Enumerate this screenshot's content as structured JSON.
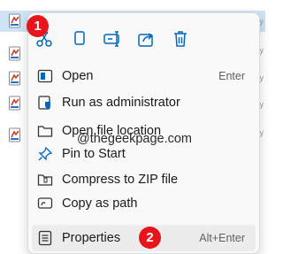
{
  "file_list": {
    "file_icons": [
      "file-icon",
      "file-icon",
      "file-icon",
      "file-icon",
      "file-icon"
    ]
  },
  "context_menu": {
    "toolbar": [
      {
        "name": "cut-icon"
      },
      {
        "name": "copy-icon"
      },
      {
        "name": "rename-icon"
      },
      {
        "name": "share-icon"
      },
      {
        "name": "delete-icon"
      }
    ],
    "items": [
      {
        "label": "Open",
        "shortcut": "Enter",
        "icon": "open-icon"
      },
      {
        "label": "Run as administrator",
        "shortcut": "",
        "icon": "admin-shield-icon"
      },
      {
        "label": "Open file location",
        "shortcut": "",
        "icon": "folder-icon"
      },
      {
        "label": "Pin to Start",
        "shortcut": "",
        "icon": "pin-icon"
      },
      {
        "label": "Compress to ZIP file",
        "shortcut": "",
        "icon": "zip-icon"
      },
      {
        "label": "Copy as path",
        "shortcut": "",
        "icon": "copy-path-icon"
      },
      {
        "label": "Properties",
        "shortcut": "Alt+Enter",
        "icon": "properties-icon"
      }
    ]
  },
  "watermark": "@thegeekpage.com",
  "annotations": {
    "badge_1": "1",
    "badge_2": "2"
  },
  "colors": {
    "badge": "#e8141b",
    "accent": "#0067c0",
    "selection": "#cfe3f7"
  }
}
